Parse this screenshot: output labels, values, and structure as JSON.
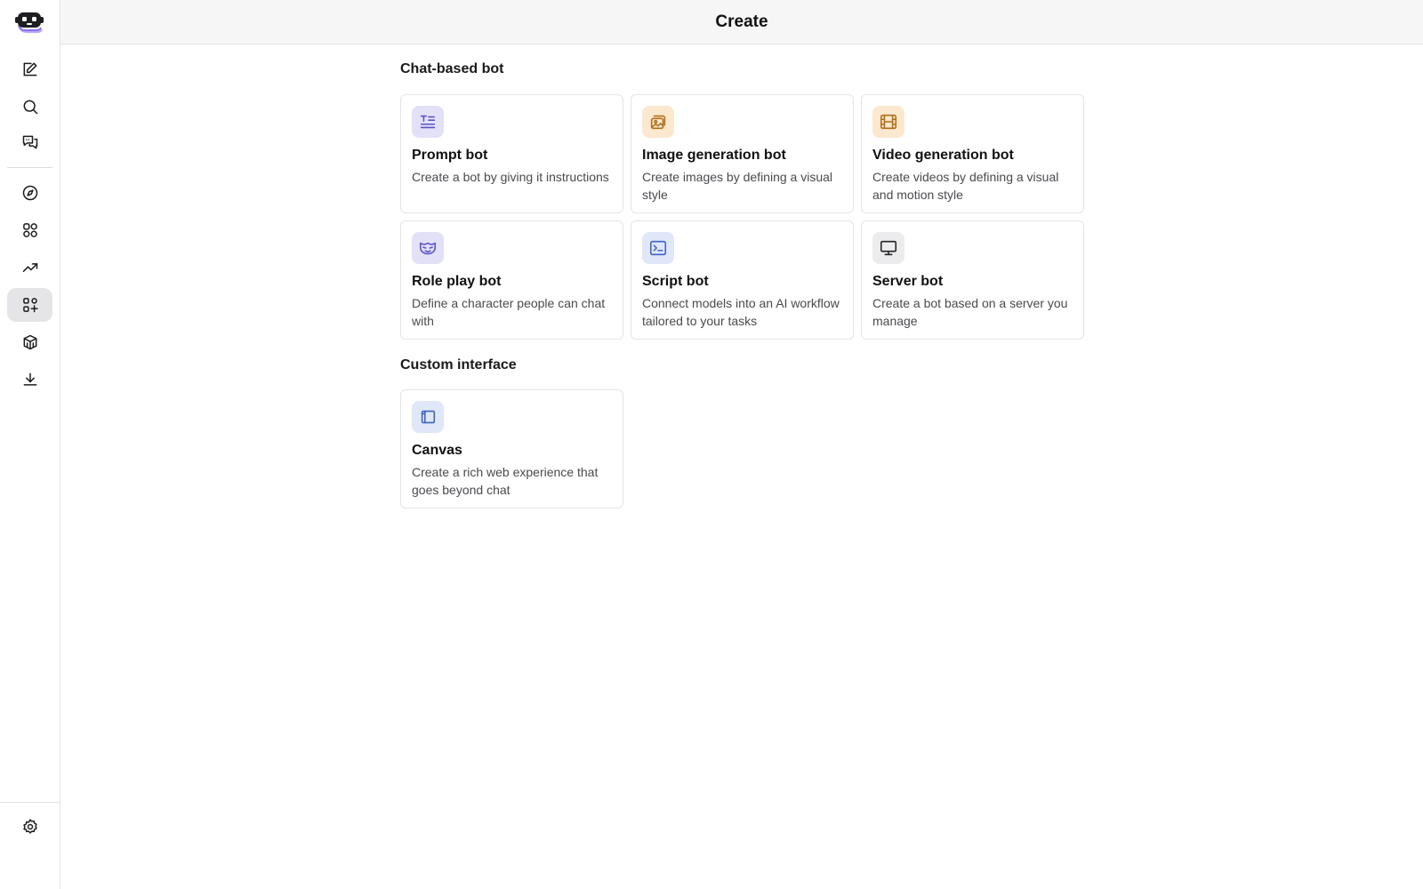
{
  "header": {
    "title": "Create"
  },
  "sidebar": {
    "items": [
      {
        "name": "new-chat",
        "icon": "compose-icon"
      },
      {
        "name": "search",
        "icon": "search-icon"
      },
      {
        "name": "chats",
        "icon": "chat-bubbles-icon"
      },
      {
        "name": "explore",
        "icon": "compass-icon"
      },
      {
        "name": "bots-apps",
        "icon": "apps-grid-icon"
      },
      {
        "name": "trending",
        "icon": "trending-up-icon"
      },
      {
        "name": "create",
        "icon": "create-plus-icon",
        "active": true
      },
      {
        "name": "models",
        "icon": "cube-icon"
      },
      {
        "name": "download",
        "icon": "download-icon"
      }
    ],
    "settings_icon": "gear-icon"
  },
  "sections": [
    {
      "title": "Chat-based bot",
      "cards": [
        {
          "title": "Prompt bot",
          "desc": "Create a bot by giving it instructions",
          "icon": "text-lines-icon",
          "color": "#5b52c7"
        },
        {
          "title": "Image generation bot",
          "desc": "Create images by defining a visual style",
          "icon": "image-stack-icon",
          "color": "#b06f17"
        },
        {
          "title": "Video generation bot",
          "desc": "Create videos by defining a visual and motion style",
          "icon": "film-icon",
          "color": "#b06f17"
        },
        {
          "title": "Role play bot",
          "desc": "Define a character people can chat with",
          "icon": "mask-icon",
          "color": "#5b52c7"
        },
        {
          "title": "Script bot",
          "desc": "Connect models into an AI workflow tailored to your tasks",
          "icon": "terminal-icon",
          "color": "#3d63c2"
        },
        {
          "title": "Server bot",
          "desc": "Create a bot based on a server you manage",
          "icon": "monitor-icon",
          "color": "#222222"
        }
      ]
    },
    {
      "title": "Custom interface",
      "cards": [
        {
          "title": "Canvas",
          "desc": "Create a rich web experience that goes beyond chat",
          "icon": "canvas-icon",
          "color": "#3d63c2"
        }
      ]
    }
  ]
}
